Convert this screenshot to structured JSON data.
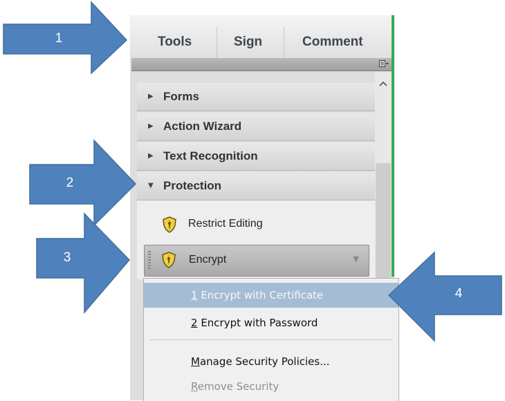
{
  "tabs": [
    {
      "label": "Tools"
    },
    {
      "label": "Sign"
    },
    {
      "label": "Comment"
    }
  ],
  "panel_icon": "view-options-icon",
  "sections": [
    {
      "label": "Forms",
      "expanded": false
    },
    {
      "label": "Action Wizard",
      "expanded": false
    },
    {
      "label": "Text Recognition",
      "expanded": false
    },
    {
      "label": "Protection",
      "expanded": true
    }
  ],
  "protection_items": {
    "restrict_editing": "Restrict Editing",
    "encrypt": "Encrypt"
  },
  "encrypt_menu": {
    "item1_key": "1",
    "item1_text": " Encrypt with Certificate",
    "item2_key": "2",
    "item2_text": " Encrypt with Password",
    "item3_key": "M",
    "item3_text": "anage Security Policies...",
    "item4_key": "R",
    "item4_text": "emove Security"
  },
  "annotations": {
    "arrow1": "1",
    "arrow2": "2",
    "arrow3": "3",
    "arrow4": "4"
  },
  "colors": {
    "arrow_fill": "#4f81bd",
    "arrow_stroke": "#41719c",
    "menu_highlight": "#a5bdd4",
    "accent_green": "#3aa757"
  }
}
